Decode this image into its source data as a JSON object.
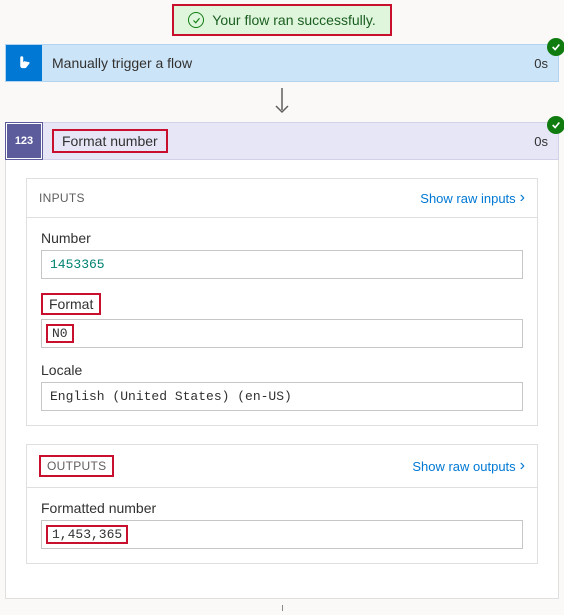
{
  "success_message": "Your flow ran successfully.",
  "trigger": {
    "title": "Manually trigger a flow",
    "timing": "0s"
  },
  "step": {
    "icon_text": "123",
    "title": "Format number",
    "timing": "0s"
  },
  "inputs": {
    "head_label": "INPUTS",
    "show_raw": "Show raw inputs",
    "fields": {
      "number_label": "Number",
      "number_value": "1453365",
      "format_label": "Format",
      "format_value": "N0",
      "locale_label": "Locale",
      "locale_value": "English (United States) (en-US)"
    }
  },
  "outputs": {
    "head_label": "OUTPUTS",
    "show_raw": "Show raw outputs",
    "fields": {
      "result_label": "Formatted number",
      "result_value": "1,453,365"
    }
  }
}
